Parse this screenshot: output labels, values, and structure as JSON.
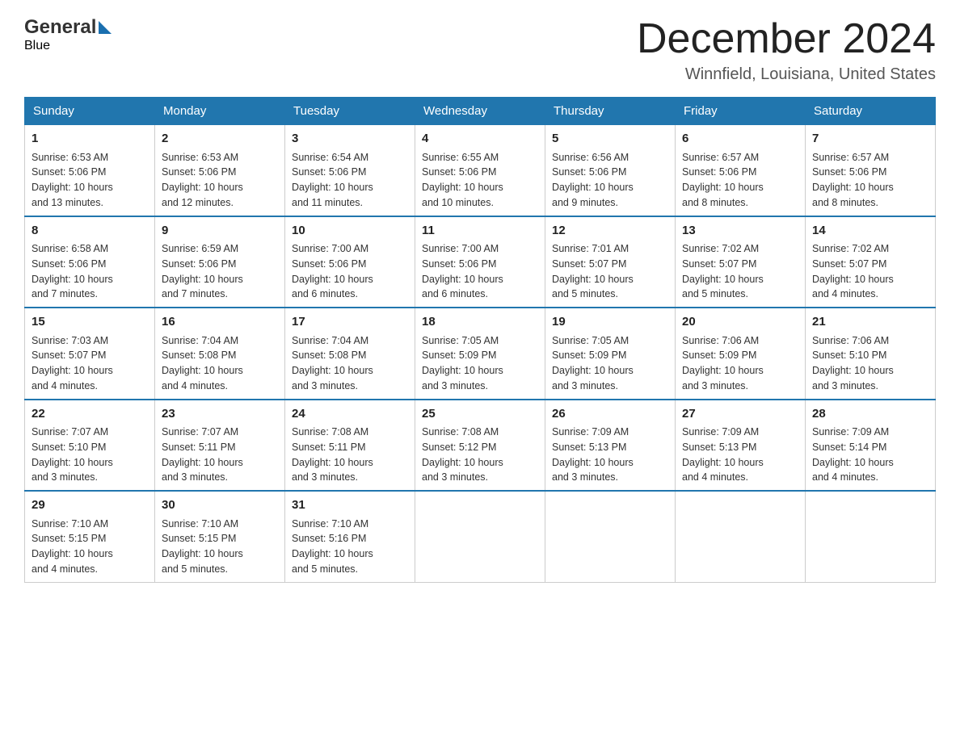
{
  "header": {
    "month_title": "December 2024",
    "location": "Winnfield, Louisiana, United States",
    "logo_general": "General",
    "logo_blue": "Blue"
  },
  "days_of_week": [
    "Sunday",
    "Monday",
    "Tuesday",
    "Wednesday",
    "Thursday",
    "Friday",
    "Saturday"
  ],
  "weeks": [
    [
      {
        "day": "1",
        "sunrise": "6:53 AM",
        "sunset": "5:06 PM",
        "daylight": "10 hours and 13 minutes."
      },
      {
        "day": "2",
        "sunrise": "6:53 AM",
        "sunset": "5:06 PM",
        "daylight": "10 hours and 12 minutes."
      },
      {
        "day": "3",
        "sunrise": "6:54 AM",
        "sunset": "5:06 PM",
        "daylight": "10 hours and 11 minutes."
      },
      {
        "day": "4",
        "sunrise": "6:55 AM",
        "sunset": "5:06 PM",
        "daylight": "10 hours and 10 minutes."
      },
      {
        "day": "5",
        "sunrise": "6:56 AM",
        "sunset": "5:06 PM",
        "daylight": "10 hours and 9 minutes."
      },
      {
        "day": "6",
        "sunrise": "6:57 AM",
        "sunset": "5:06 PM",
        "daylight": "10 hours and 8 minutes."
      },
      {
        "day": "7",
        "sunrise": "6:57 AM",
        "sunset": "5:06 PM",
        "daylight": "10 hours and 8 minutes."
      }
    ],
    [
      {
        "day": "8",
        "sunrise": "6:58 AM",
        "sunset": "5:06 PM",
        "daylight": "10 hours and 7 minutes."
      },
      {
        "day": "9",
        "sunrise": "6:59 AM",
        "sunset": "5:06 PM",
        "daylight": "10 hours and 7 minutes."
      },
      {
        "day": "10",
        "sunrise": "7:00 AM",
        "sunset": "5:06 PM",
        "daylight": "10 hours and 6 minutes."
      },
      {
        "day": "11",
        "sunrise": "7:00 AM",
        "sunset": "5:06 PM",
        "daylight": "10 hours and 6 minutes."
      },
      {
        "day": "12",
        "sunrise": "7:01 AM",
        "sunset": "5:07 PM",
        "daylight": "10 hours and 5 minutes."
      },
      {
        "day": "13",
        "sunrise": "7:02 AM",
        "sunset": "5:07 PM",
        "daylight": "10 hours and 5 minutes."
      },
      {
        "day": "14",
        "sunrise": "7:02 AM",
        "sunset": "5:07 PM",
        "daylight": "10 hours and 4 minutes."
      }
    ],
    [
      {
        "day": "15",
        "sunrise": "7:03 AM",
        "sunset": "5:07 PM",
        "daylight": "10 hours and 4 minutes."
      },
      {
        "day": "16",
        "sunrise": "7:04 AM",
        "sunset": "5:08 PM",
        "daylight": "10 hours and 4 minutes."
      },
      {
        "day": "17",
        "sunrise": "7:04 AM",
        "sunset": "5:08 PM",
        "daylight": "10 hours and 3 minutes."
      },
      {
        "day": "18",
        "sunrise": "7:05 AM",
        "sunset": "5:09 PM",
        "daylight": "10 hours and 3 minutes."
      },
      {
        "day": "19",
        "sunrise": "7:05 AM",
        "sunset": "5:09 PM",
        "daylight": "10 hours and 3 minutes."
      },
      {
        "day": "20",
        "sunrise": "7:06 AM",
        "sunset": "5:09 PM",
        "daylight": "10 hours and 3 minutes."
      },
      {
        "day": "21",
        "sunrise": "7:06 AM",
        "sunset": "5:10 PM",
        "daylight": "10 hours and 3 minutes."
      }
    ],
    [
      {
        "day": "22",
        "sunrise": "7:07 AM",
        "sunset": "5:10 PM",
        "daylight": "10 hours and 3 minutes."
      },
      {
        "day": "23",
        "sunrise": "7:07 AM",
        "sunset": "5:11 PM",
        "daylight": "10 hours and 3 minutes."
      },
      {
        "day": "24",
        "sunrise": "7:08 AM",
        "sunset": "5:11 PM",
        "daylight": "10 hours and 3 minutes."
      },
      {
        "day": "25",
        "sunrise": "7:08 AM",
        "sunset": "5:12 PM",
        "daylight": "10 hours and 3 minutes."
      },
      {
        "day": "26",
        "sunrise": "7:09 AM",
        "sunset": "5:13 PM",
        "daylight": "10 hours and 3 minutes."
      },
      {
        "day": "27",
        "sunrise": "7:09 AM",
        "sunset": "5:13 PM",
        "daylight": "10 hours and 4 minutes."
      },
      {
        "day": "28",
        "sunrise": "7:09 AM",
        "sunset": "5:14 PM",
        "daylight": "10 hours and 4 minutes."
      }
    ],
    [
      {
        "day": "29",
        "sunrise": "7:10 AM",
        "sunset": "5:15 PM",
        "daylight": "10 hours and 4 minutes."
      },
      {
        "day": "30",
        "sunrise": "7:10 AM",
        "sunset": "5:15 PM",
        "daylight": "10 hours and 5 minutes."
      },
      {
        "day": "31",
        "sunrise": "7:10 AM",
        "sunset": "5:16 PM",
        "daylight": "10 hours and 5 minutes."
      },
      null,
      null,
      null,
      null
    ]
  ],
  "labels": {
    "sunrise": "Sunrise:",
    "sunset": "Sunset:",
    "daylight": "Daylight:"
  }
}
